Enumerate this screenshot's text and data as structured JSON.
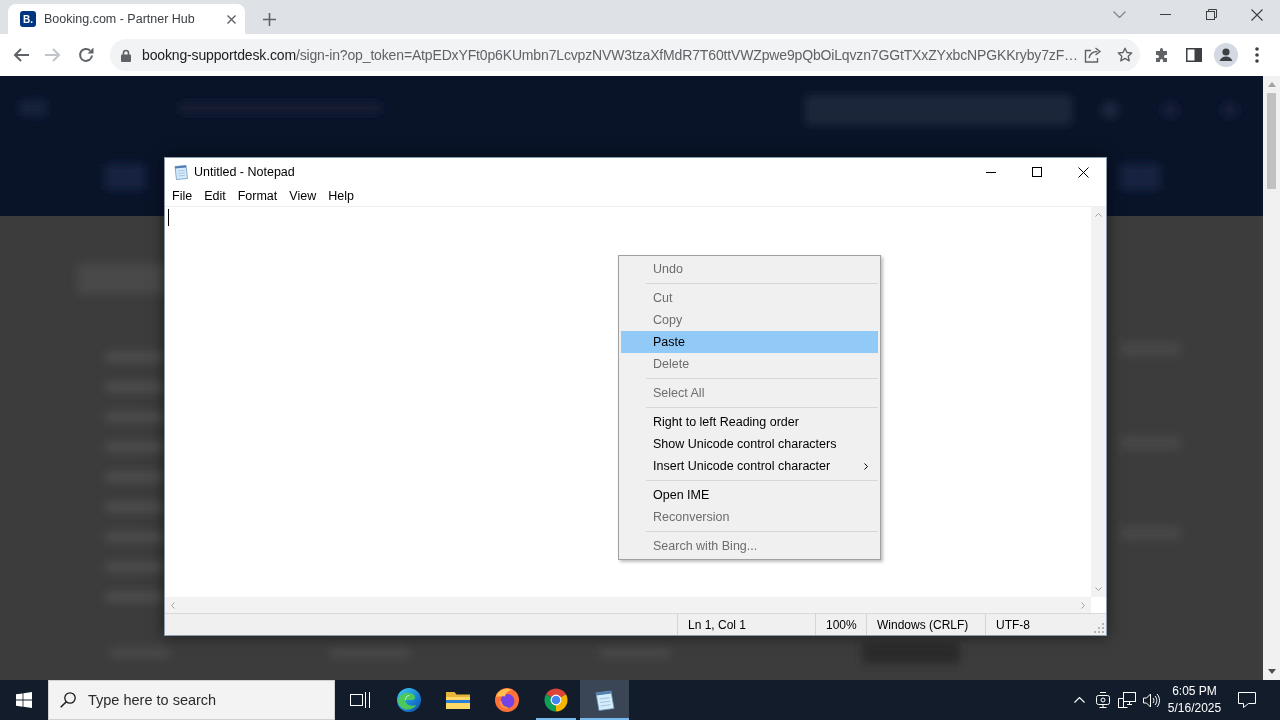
{
  "browser": {
    "tabs": [
      {
        "favicon": "B.",
        "title": "Booking.com - Partner Hub",
        "selected": true
      }
    ],
    "navigation": {
      "back_disabled": false,
      "forward_disabled": true
    },
    "address_bar": {
      "host": "bookng-supportdesk.com",
      "path": "/sign-in?op_token=AtpEDxYFt0p6KUmbn7LcvpzNVW3tzaXfMdR7T60ttVWZpwe9pQbOiLqvzn7GGtTXxZYxbcNPGKKryby7zF…"
    }
  },
  "notepad": {
    "title": "Untitled - Notepad",
    "menu": [
      "File",
      "Edit",
      "Format",
      "View",
      "Help"
    ],
    "context_menu": [
      {
        "kind": "item",
        "label": "Undo",
        "disabled": true,
        "selected": false,
        "submenu": false
      },
      {
        "kind": "separator"
      },
      {
        "kind": "item",
        "label": "Cut",
        "disabled": true,
        "selected": false,
        "submenu": false
      },
      {
        "kind": "item",
        "label": "Copy",
        "disabled": true,
        "selected": false,
        "submenu": false
      },
      {
        "kind": "item",
        "label": "Paste",
        "disabled": false,
        "selected": true,
        "submenu": false
      },
      {
        "kind": "item",
        "label": "Delete",
        "disabled": true,
        "selected": false,
        "submenu": false
      },
      {
        "kind": "separator"
      },
      {
        "kind": "item",
        "label": "Select All",
        "disabled": true,
        "selected": false,
        "submenu": false
      },
      {
        "kind": "separator"
      },
      {
        "kind": "item",
        "label": "Right to left Reading order",
        "disabled": false,
        "selected": false,
        "submenu": false
      },
      {
        "kind": "item",
        "label": "Show Unicode control characters",
        "disabled": false,
        "selected": false,
        "submenu": false
      },
      {
        "kind": "item",
        "label": "Insert Unicode control character",
        "disabled": false,
        "selected": false,
        "submenu": true
      },
      {
        "kind": "separator"
      },
      {
        "kind": "item",
        "label": "Open IME",
        "disabled": false,
        "selected": false,
        "submenu": false
      },
      {
        "kind": "item",
        "label": "Reconversion",
        "disabled": true,
        "selected": false,
        "submenu": false
      },
      {
        "kind": "separator"
      },
      {
        "kind": "item",
        "label": "Search with Bing...",
        "disabled": true,
        "selected": false,
        "submenu": false
      }
    ],
    "status_bar": [
      "Ln 1, Col 1",
      "100%",
      "Windows (CRLF)",
      "UTF-8"
    ]
  },
  "taskbar": {
    "search": {
      "placeholder": "Type here to search"
    },
    "apps": [
      {
        "kind": "task_view",
        "running": false,
        "selected": false
      },
      {
        "kind": "edge",
        "running": false,
        "selected": false
      },
      {
        "kind": "explorer",
        "running": false,
        "selected": false
      },
      {
        "kind": "firefox",
        "running": false,
        "selected": false
      },
      {
        "kind": "chrome",
        "running": true,
        "selected": false
      },
      {
        "kind": "notepad",
        "running": true,
        "selected": true
      }
    ],
    "clock": {
      "time": "6:05 PM",
      "date": "5/16/2025"
    }
  }
}
